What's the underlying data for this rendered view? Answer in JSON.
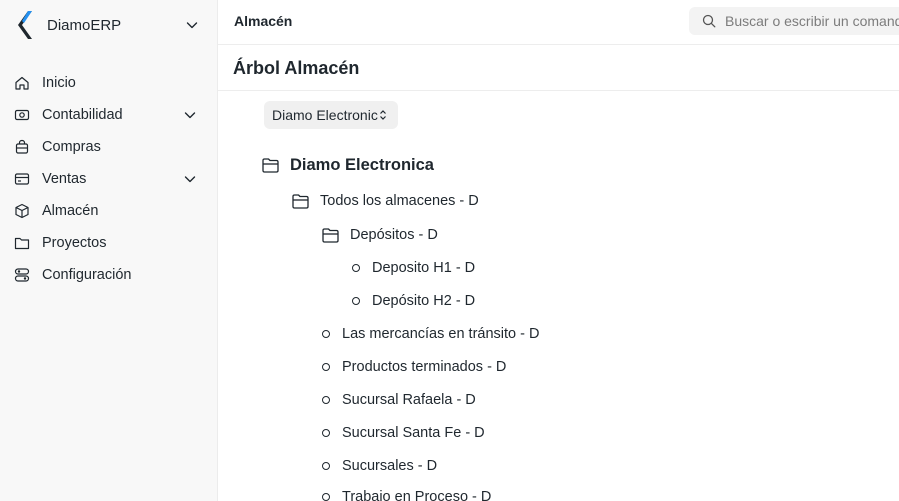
{
  "app": {
    "name": "DiamoERP"
  },
  "sidebar": {
    "items": [
      {
        "label": "Inicio",
        "icon": "home-icon",
        "expandable": false
      },
      {
        "label": "Contabilidad",
        "icon": "accounting-icon",
        "expandable": true
      },
      {
        "label": "Compras",
        "icon": "shopping-bag-icon",
        "expandable": false
      },
      {
        "label": "Ventas",
        "icon": "sales-card-icon",
        "expandable": true
      },
      {
        "label": "Almacén",
        "icon": "box-icon",
        "expandable": false
      },
      {
        "label": "Proyectos",
        "icon": "folder-icon",
        "expandable": false
      },
      {
        "label": "Configuración",
        "icon": "settings-icon",
        "expandable": false
      }
    ]
  },
  "topbar": {
    "breadcrumb": "Almacén",
    "search_placeholder": "Buscar o escribir un comando (Ctrl + G)"
  },
  "page": {
    "title": "Árbol Almacén",
    "company_filter": "Diamo Electronica"
  },
  "tree": {
    "root": "Diamo Electronica",
    "group_all": "Todos los almacenes - D",
    "group_deposits": "Depósitos - D",
    "deposit_h1": "Deposito H1 - D",
    "deposit_h2": "Depósito H2 - D",
    "transit": "Las mercancías en tránsito - D",
    "finished": "Productos terminados - D",
    "rafaela": "Sucursal Rafaela - D",
    "santa_fe": "Sucursal Santa Fe - D",
    "branches": "Sucursales - D",
    "wip": "Trabajo en Proceso - D"
  },
  "colors": {
    "text": "#1f272e",
    "sidebar_bg": "#f8f8f8",
    "logo_dark": "#1f272e",
    "logo_blue": "#2490ef"
  }
}
